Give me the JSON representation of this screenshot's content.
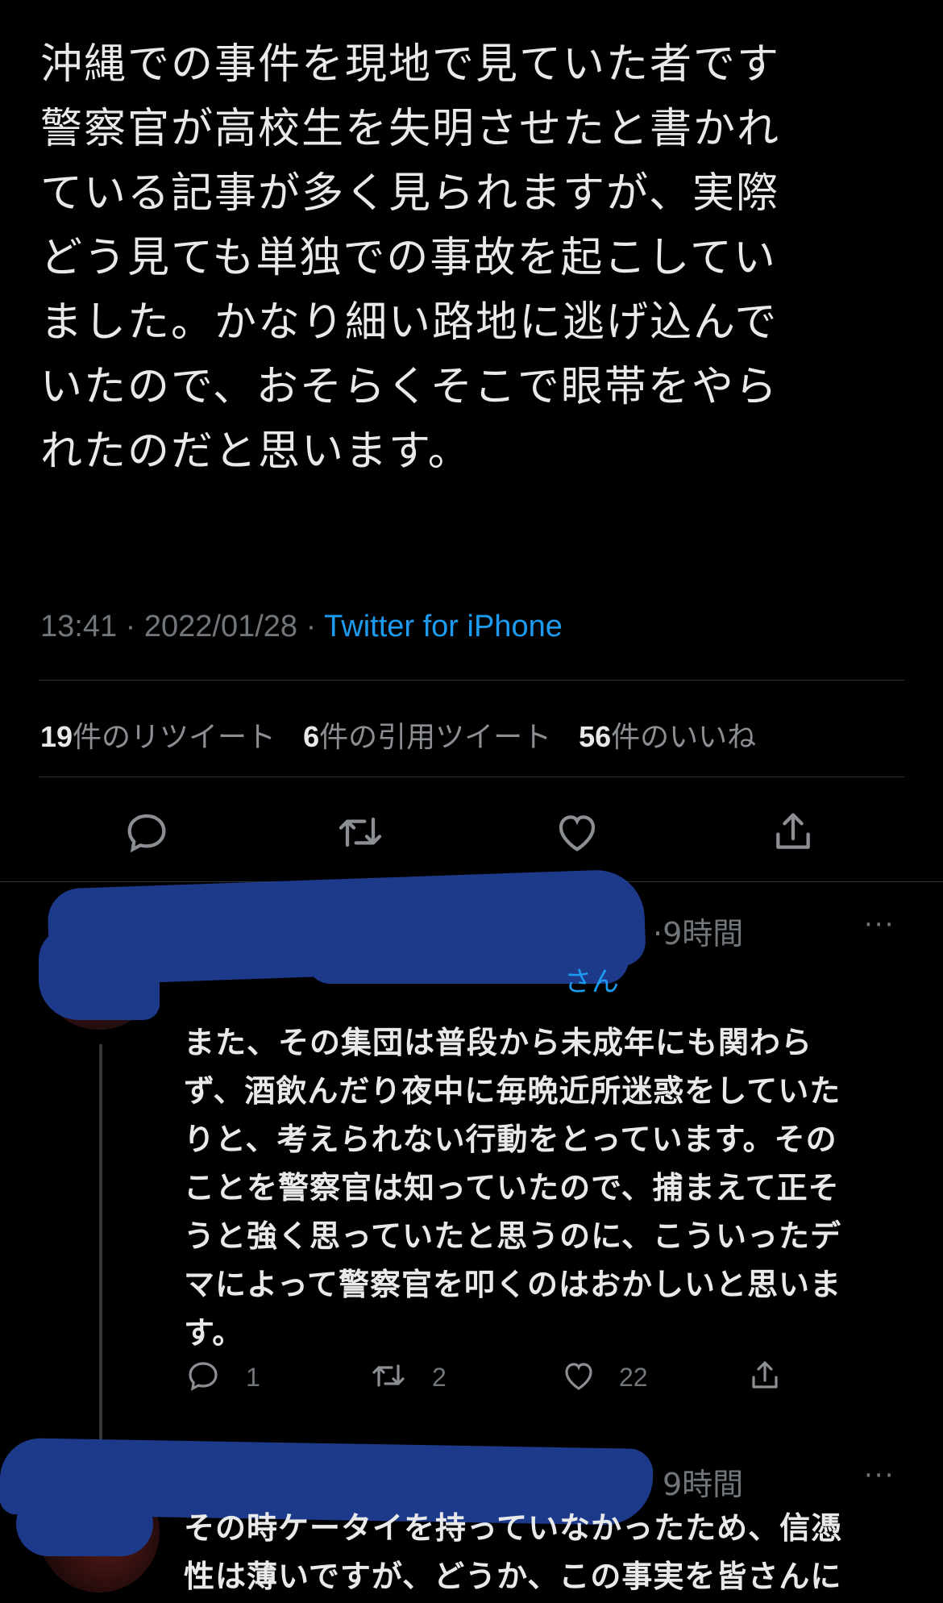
{
  "tweet": {
    "text": "沖縄での事件を現地で見ていた者です\n警察官が高校生を失明させたと書かれ\nている記事が多く見られますが、実際\nどう見ても単独での事故を起こしてい\nました。かなり細い路地に逃げ込んで\nいたので、おそらくそこで眼帯をやら\nれたのだと思います。",
    "time": "13:41",
    "date": "2022/01/28",
    "sep": " · ",
    "source": "Twitter for iPhone",
    "retweets_count": "19",
    "retweets_label": "件のリツイート",
    "quotes_count": "6",
    "quotes_label": "件の引用ツイート",
    "likes_count": "56",
    "likes_label": "件のいいね"
  },
  "replies": [
    {
      "time_ago": "·9時間",
      "more": "···",
      "reply_to": "さん",
      "text": "また、その集団は普段から未成年にも関わら\nず、酒飲んだり夜中に毎晩近所迷惑をしていた\nりと、考えられない行動をとっています。その\nことを警察官は知っていたので、捕まえて正そ\nうと強く思っていたと思うのに、こういったデ\nマによって警察官を叩くのはおかしいと思いま\nす。",
      "reply_count": "1",
      "retweet_count": "2",
      "like_count": "22"
    },
    {
      "time_ago": "9時間",
      "more": "···",
      "text": "その時ケータイを持っていなかったため、信憑\n性は薄いですが、どうか、この事実を皆さんに"
    }
  ],
  "colors": {
    "background": "#000000",
    "text": "#e7e9ea",
    "muted": "#71767b",
    "accent": "#1d9bf0",
    "redaction": "#1d3a8a"
  },
  "icons": [
    "reply-icon",
    "retweet-icon",
    "like-icon",
    "share-icon",
    "more-icon"
  ]
}
